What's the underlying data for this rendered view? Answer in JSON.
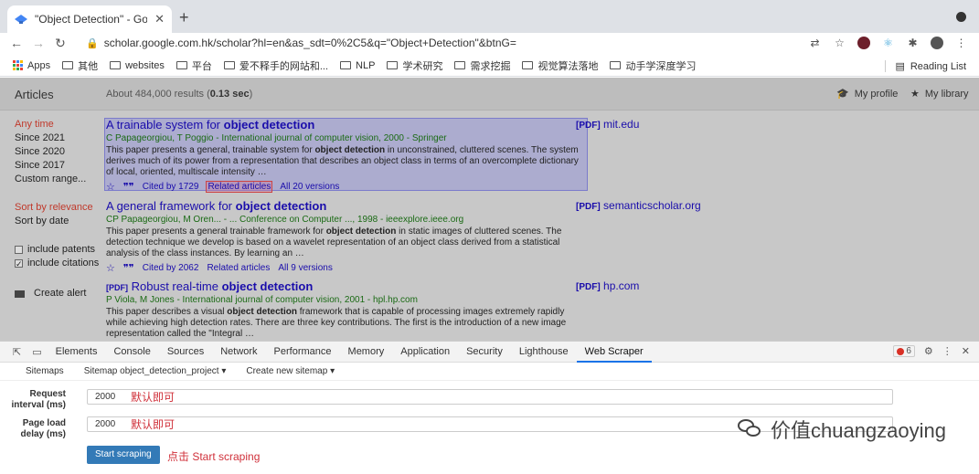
{
  "browser": {
    "tab_title": "\"Object Detection\" - Google S",
    "tab_close": "✕",
    "new_tab": "+",
    "url": "scholar.google.com.hk/scholar?hl=en&as_sdt=0%2C5&q=\"Object+Detection\"&btnG=",
    "bookmarks": [
      "Apps",
      "其他",
      "websites",
      "平台",
      "爱不释手的网站和...",
      "NLP",
      "学术研究",
      "需求挖掘",
      "视觉算法落地",
      "动手学深度学习"
    ],
    "reading_list": "Reading List"
  },
  "scholar": {
    "articles_label": "Articles",
    "results_prefix": "About 484,000 results (",
    "results_time": "0.13 sec",
    "results_suffix": ")",
    "my_profile": "My profile",
    "my_library": "My library",
    "sidebar_time": [
      "Any time",
      "Since 2021",
      "Since 2020",
      "Since 2017",
      "Custom range..."
    ],
    "sort": [
      "Sort by relevance",
      "Sort by date"
    ],
    "include_patents": "include patents",
    "include_citations": "include citations",
    "create_alert": "Create alert",
    "results": [
      {
        "title_plain": "A trainable system for ",
        "title_bold": "object detection",
        "pdf_tag": "[PDF]",
        "pdf_source": "mit.edu",
        "authors": "C Papageorgiou, T Poggio - International journal of computer vision, 2000 - Springer",
        "snippet": "This paper presents a general, trainable system for <b>object detection</b> in unconstrained, cluttered scenes. The system derives much of its power from a representation that describes an object class in terms of an overcomplete dictionary of local, oriented, multiscale intensity …",
        "cited_by": "Cited by 1729",
        "related": "Related articles",
        "versions": "All 20 versions"
      },
      {
        "title_plain": "A general framework for ",
        "title_bold": "object detection",
        "pdf_tag": "[PDF]",
        "pdf_source": "semanticscholar.org",
        "authors": "CP Papageorgiou, M Oren... - ... Conference on Computer ..., 1998 - ieeexplore.ieee.org",
        "snippet": "This paper presents a general trainable framework for <b>object detection</b> in static images of cluttered scenes. The detection technique we develop is based on a wavelet representation of an object class derived from a statistical analysis of the class instances. By learning an …",
        "cited_by": "Cited by 2062",
        "related": "Related articles",
        "versions": "All 9 versions"
      },
      {
        "title_prefix": "[PDF]",
        "title_plain": "Robust real-time ",
        "title_bold": "object detection",
        "pdf_tag": "[PDF]",
        "pdf_source": "hp.com",
        "authors": "P Viola, M Jones - International journal of computer vision, 2001 - hpl.hp.com",
        "snippet": "This paper describes a visual <b>object detection</b> framework that is capable of processing images extremely rapidly while achieving high detection rates. There are three key contributions. The first is the introduction of a new image representation called the \"Integral …"
      }
    ]
  },
  "devtools": {
    "tabs": [
      "Elements",
      "Console",
      "Sources",
      "Network",
      "Performance",
      "Memory",
      "Application",
      "Security",
      "Lighthouse",
      "Web Scraper"
    ],
    "error_count": "6",
    "scraper_nav": [
      "Sitemaps",
      "Sitemap object_detection_project ▾",
      "Create new sitemap ▾"
    ],
    "request_interval_label": "Request interval (ms)",
    "request_interval_value": "2000",
    "page_load_delay_label": "Page load delay (ms)",
    "page_load_delay_value": "2000",
    "note_default": "默认即可",
    "start_button": "Start scraping",
    "note_click": "点击 Start scraping"
  },
  "watermark": "价值chuangzaoying",
  "colors": {
    "link": "#1a0dab",
    "green": "#1a6a14",
    "accent_red": "#c0392b",
    "button_blue": "#337ab7"
  }
}
